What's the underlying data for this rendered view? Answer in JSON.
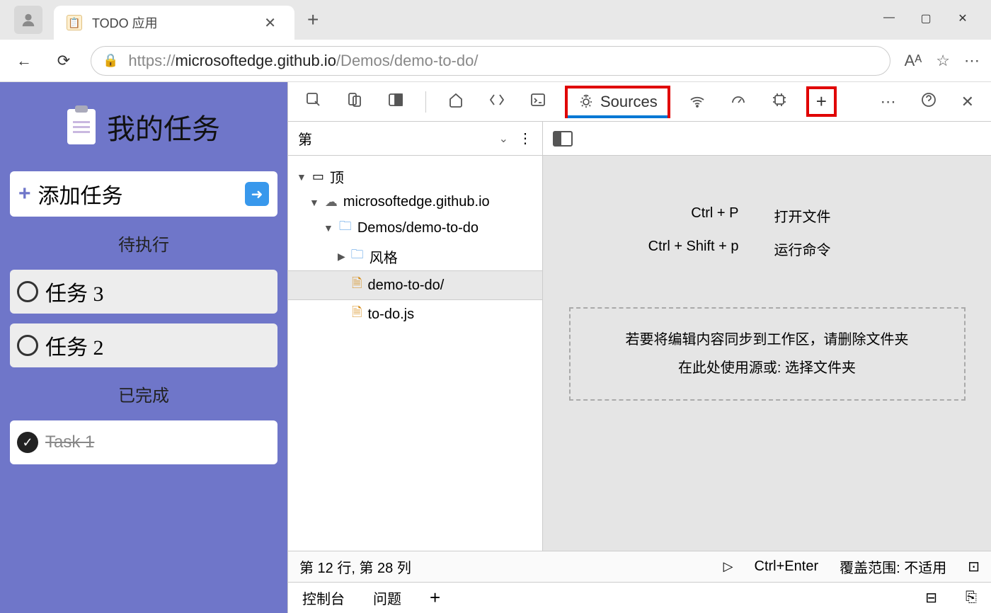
{
  "browser": {
    "tab_title": "TODO 应用",
    "url_prefix": "https://",
    "url_host": "microsoftedge.github.io",
    "url_path": "/Demos/demo-to-do/",
    "read_aloud": "Aᴬ"
  },
  "app": {
    "title": "我的任务",
    "add_label": "添加任务",
    "pending_label": "待执行",
    "done_label": "已完成",
    "pending": [
      "任务 3",
      "任务 2"
    ],
    "completed": [
      "Task 1"
    ]
  },
  "devtools": {
    "active_tab": "Sources",
    "sub_tab": "第",
    "tree": {
      "top": "顶",
      "host": "microsoftedge.github.io",
      "path": "Demos/demo-to-do",
      "folder": "风格",
      "file_html": "demo-to-do/",
      "file_js": "to-do.js"
    },
    "shortcuts": {
      "open_key": "Ctrl + P",
      "open_label": "打开文件",
      "run_key": "Ctrl + Shift + p",
      "run_label": "运行命令"
    },
    "drop_line1": "若要将编辑内容同步到工作区，请删除文件夹",
    "drop_line2": "在此处使用源或: 选择文件夹",
    "status": {
      "position": "第 12 行, 第 28 列",
      "run": "Ctrl+Enter",
      "coverage": "覆盖范围: 不适用"
    },
    "footer": {
      "console": "控制台",
      "issues": "问题"
    }
  }
}
